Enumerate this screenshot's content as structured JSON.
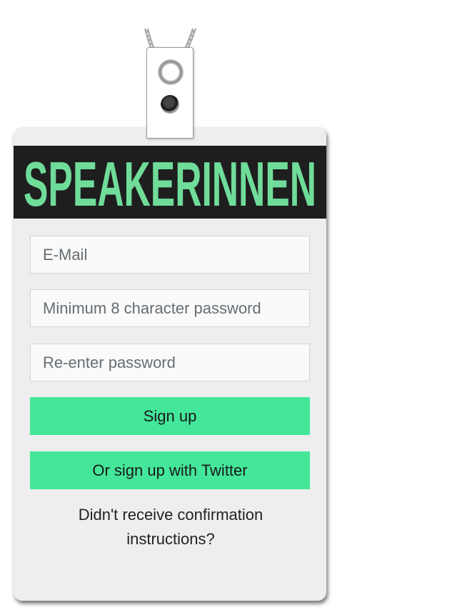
{
  "brand": {
    "logo_text": "SPEAKERINNEN",
    "logo_color": "#6fdc9a",
    "banner_color": "#1e1e1e"
  },
  "form": {
    "email_placeholder": "E-Mail",
    "password_placeholder": "Minimum 8 character password",
    "password_confirm_placeholder": "Re-enter password"
  },
  "actions": {
    "signup_label": "Sign up",
    "twitter_label": "Or sign up with Twitter",
    "confirmation_link": "Didn't receive confirmation instructions?",
    "button_color": "#44e79a"
  },
  "icons": [
    "lanyard-cord-icon",
    "grommet-icon",
    "punch-hole-icon"
  ]
}
